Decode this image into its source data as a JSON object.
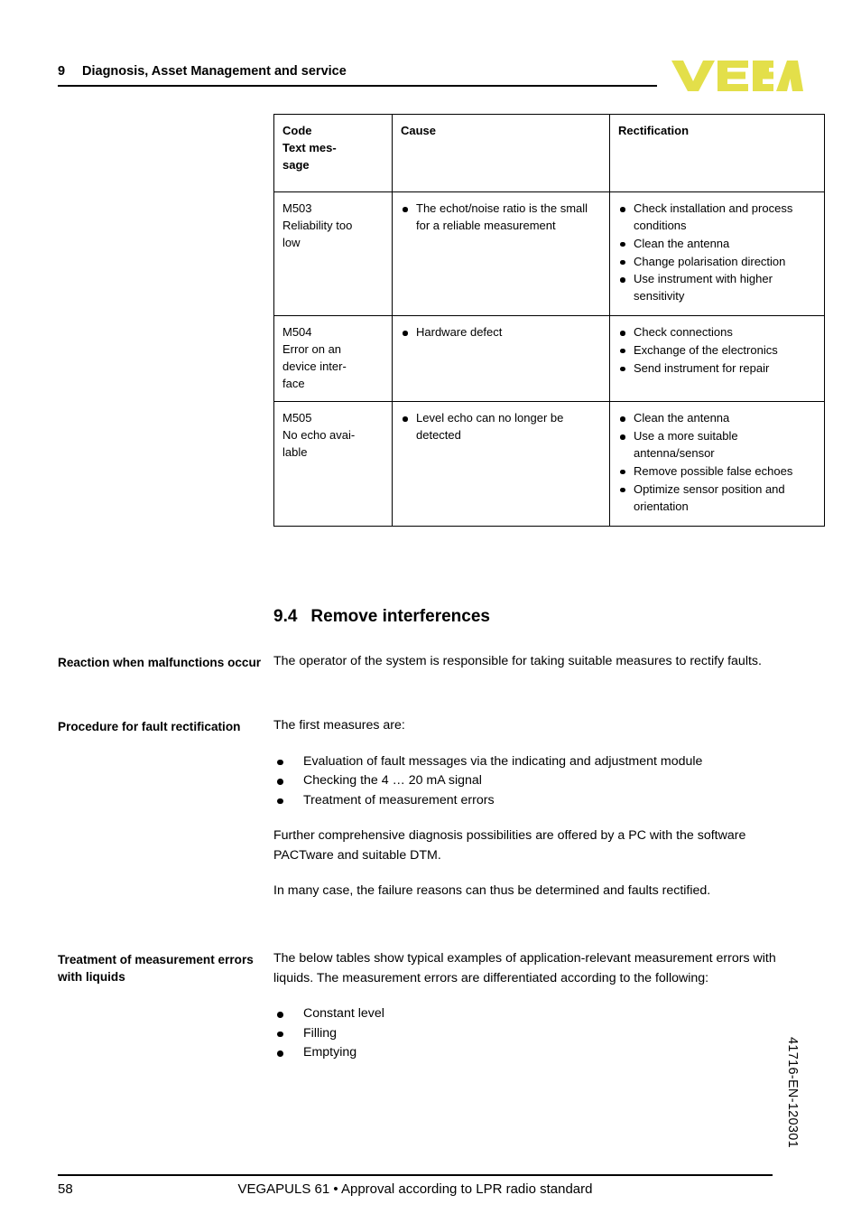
{
  "header": {
    "chapter_number": "9",
    "chapter_title": "Diagnosis, Asset Management and service",
    "logo_text": "VEGA",
    "logo_color": "#e3df4a"
  },
  "table": {
    "headers": {
      "code_line1": "Code",
      "code_line2": "Text mes-",
      "code_line3": "sage",
      "cause": "Cause",
      "rectification": "Rectification"
    },
    "rows": [
      {
        "code_lines": [
          "M503",
          "Reliability too",
          "low"
        ],
        "causes": [
          "The echot/noise ratio is the small for a reliable measurement"
        ],
        "rectifications": [
          "Check installation and process conditions",
          "Clean the antenna",
          "Change polarisation direction",
          "Use instrument with higher sensitivity"
        ]
      },
      {
        "code_lines": [
          "M504",
          "Error on an",
          "device inter-",
          "face"
        ],
        "causes": [
          "Hardware defect"
        ],
        "rectifications": [
          "Check connections",
          "Exchange of the electronics",
          "Send instrument for repair"
        ]
      },
      {
        "code_lines": [
          "M505",
          "No echo avai-",
          "lable"
        ],
        "causes": [
          "Level echo can no longer be detected"
        ],
        "rectifications": [
          "Clean the antenna",
          "Use a more suitable antenna/sensor",
          "Remove possible false echoes",
          "Optimize sensor position and orientation"
        ]
      }
    ]
  },
  "section": {
    "number": "9.4",
    "title": "Remove interferences"
  },
  "blocks": {
    "reaction": {
      "margin_title": "Reaction when malfunctions occur",
      "paragraph": "The operator of the system is responsible for taking suitable measures to rectify faults."
    },
    "procedure": {
      "margin_title": "Procedure for fault rectification",
      "intro": "The first measures are:",
      "bullets": [
        "Evaluation of fault messages via the indicating and adjustment module",
        "Checking the 4 … 20 mA signal",
        "Treatment of measurement errors"
      ],
      "paragraph_2": "Further comprehensive diagnosis possibilities are offered by a PC with the software PACTware and suitable DTM.",
      "paragraph_3": "In many case, the failure reasons can thus be determined and faults rectified."
    },
    "treatment": {
      "margin_title": "Treatment of measurement errors with liquids",
      "paragraph": "The below tables show typical examples of application-relevant measurement errors with liquids. The measurement errors are differentiated according to the following:",
      "bullets": [
        "Constant level",
        "Filling",
        "Emptying"
      ]
    }
  },
  "doc_code": "41716-EN-120301",
  "footer": {
    "page_number": "58",
    "doc_title": "VEGAPULS 61 • Approval according to LPR radio standard"
  }
}
